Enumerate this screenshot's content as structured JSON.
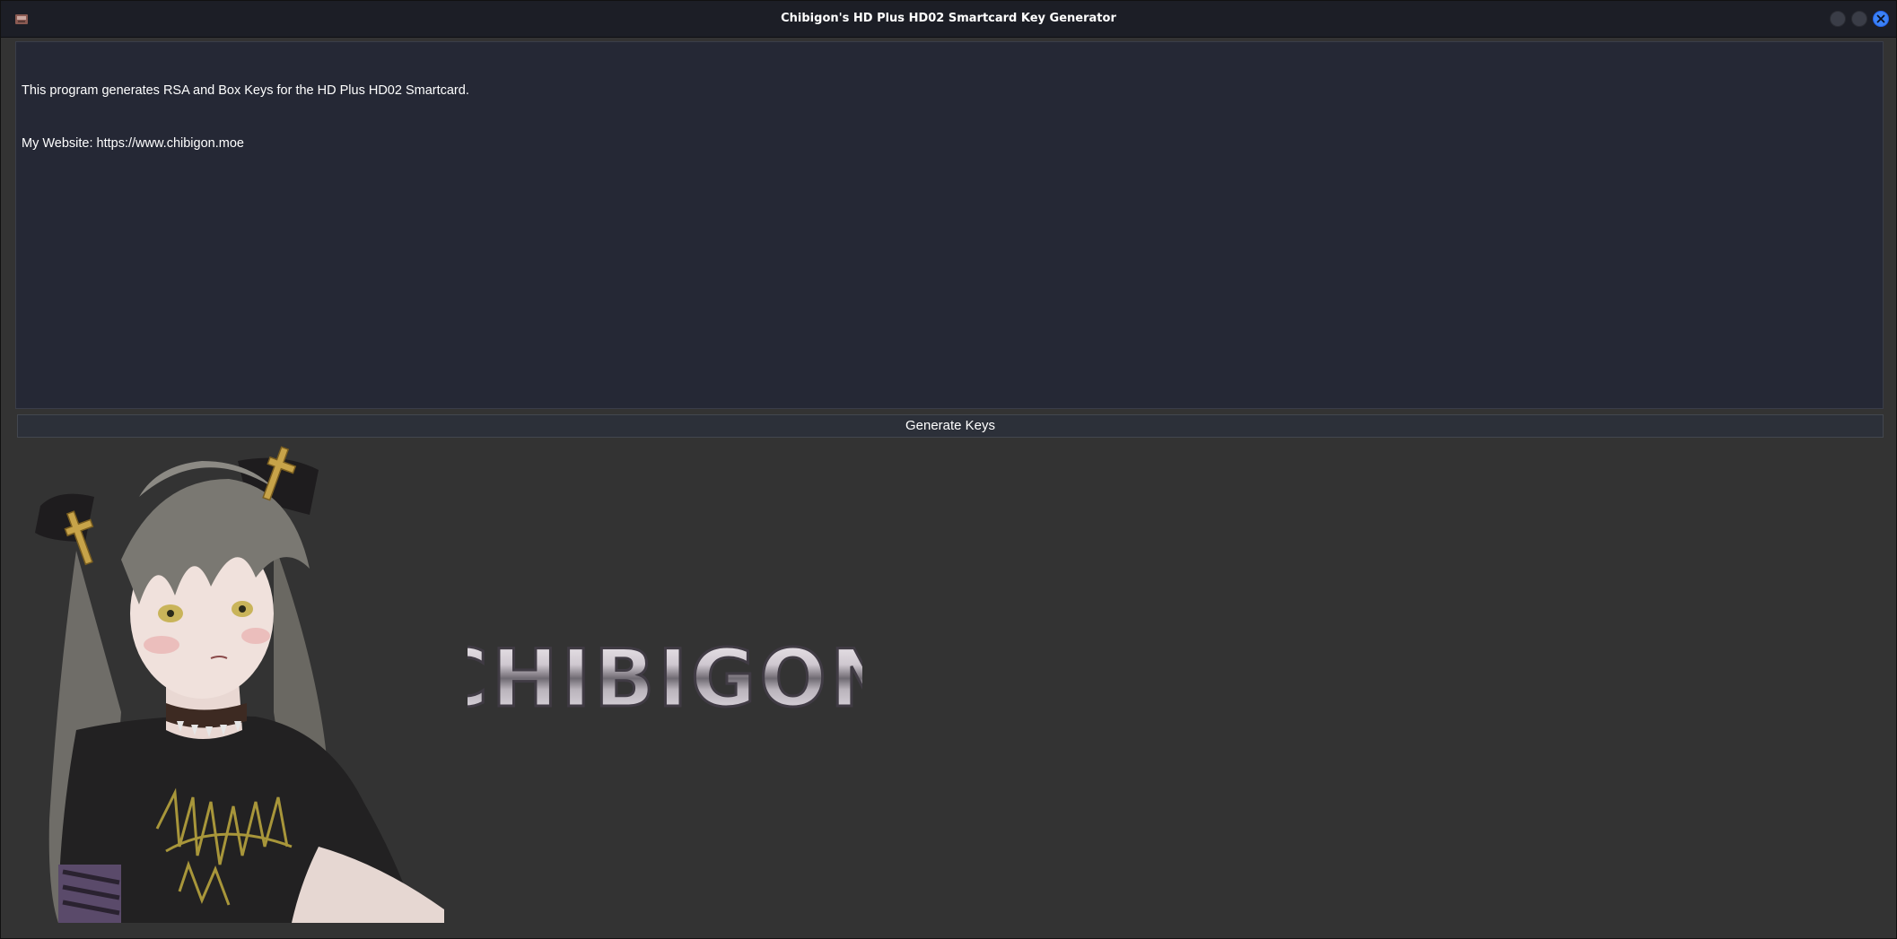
{
  "window": {
    "title": "Chibigon's HD Plus HD02 Smartcard Key Generator",
    "controls": [
      "minimize",
      "maximize",
      "close"
    ]
  },
  "output": {
    "lines": [
      "This program generates RSA and Box Keys for the HD Plus HD02 Smartcard.",
      "My Website: https://www.chibigon.moe"
    ]
  },
  "actions": {
    "generate_label": "Generate Keys"
  },
  "banner": {
    "logo_text": "CHIBIGON"
  },
  "colors": {
    "window_bg": "#333333",
    "textarea_bg": "#252835",
    "button_bg": "#2c3039",
    "titlebar_bg": "#1c1e26",
    "close_accent": "#3b82f6",
    "text": "#ffffff"
  }
}
